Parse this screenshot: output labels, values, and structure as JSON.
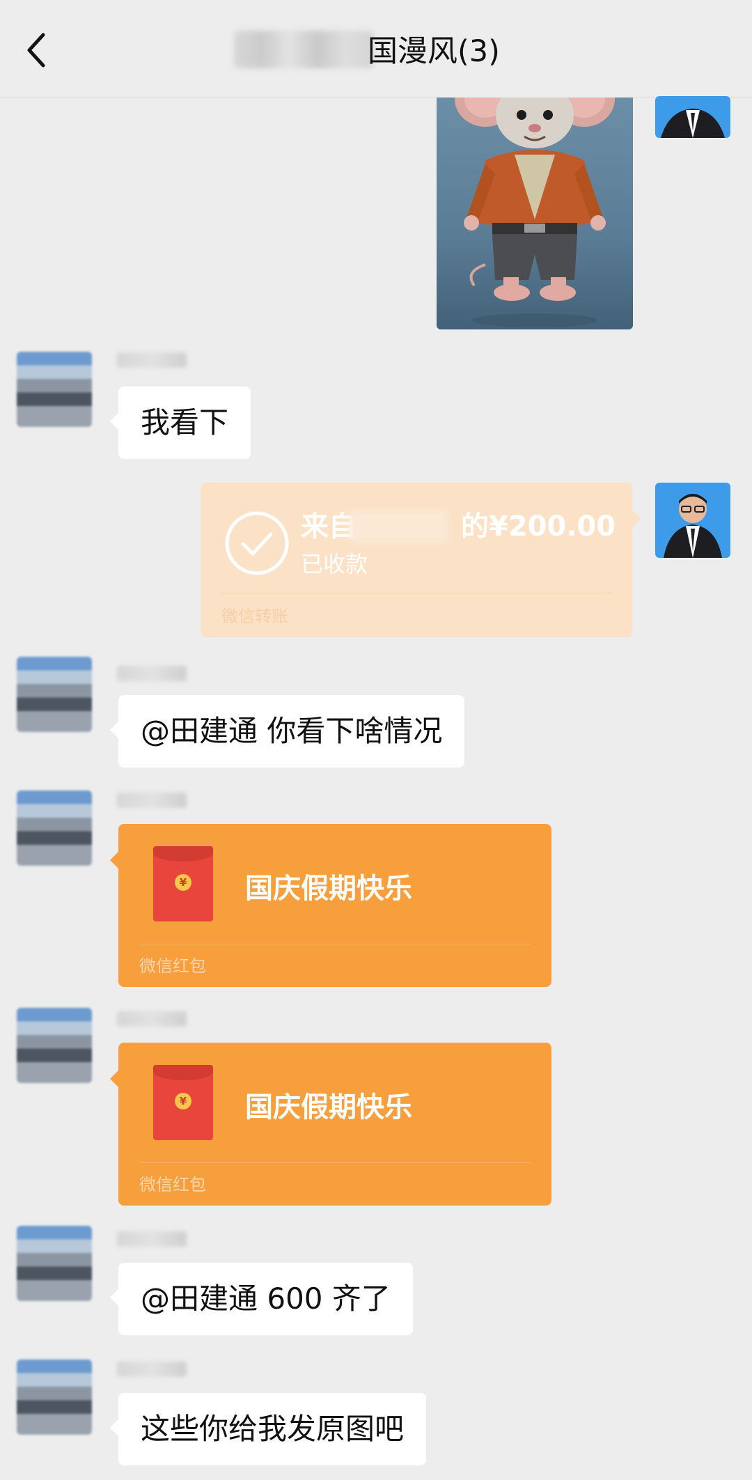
{
  "header": {
    "title": "国漫风(3)"
  },
  "messages": {
    "text_1": "我看下",
    "transfer": {
      "amount_prefix": "来自",
      "amount_suffix": "的¥200.00",
      "status": "已收款",
      "source": "微信转账"
    },
    "text_2": "@田建通  你看下啥情况",
    "redpacket_1": {
      "title": "国庆假期快乐",
      "source": "微信红包",
      "coin": "¥"
    },
    "redpacket_2": {
      "title": "国庆假期快乐",
      "source": "微信红包",
      "coin": "¥"
    },
    "text_3": "@田建通  600 齐了",
    "text_4": "这些你给我发原图吧"
  },
  "colors": {
    "background": "#ededed",
    "bubble": "#ffffff",
    "transfer_received": "#fbe2c7",
    "redpacket": "#f79e3d",
    "self_avatar_bg": "#3d9be9"
  }
}
